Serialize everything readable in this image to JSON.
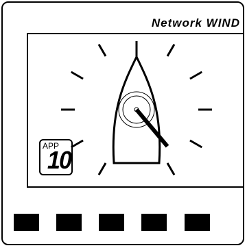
{
  "header": {
    "title": "Network  WIND"
  },
  "wind": {
    "mode_label": "APP",
    "speed_value": "10",
    "apparent_angle_deg": 140
  },
  "softkeys": [
    {
      "name": "softkey-1"
    },
    {
      "name": "softkey-2"
    },
    {
      "name": "softkey-3"
    },
    {
      "name": "softkey-4"
    },
    {
      "name": "softkey-5"
    }
  ],
  "colors": {
    "ink": "#000000",
    "background": "#ffffff"
  }
}
